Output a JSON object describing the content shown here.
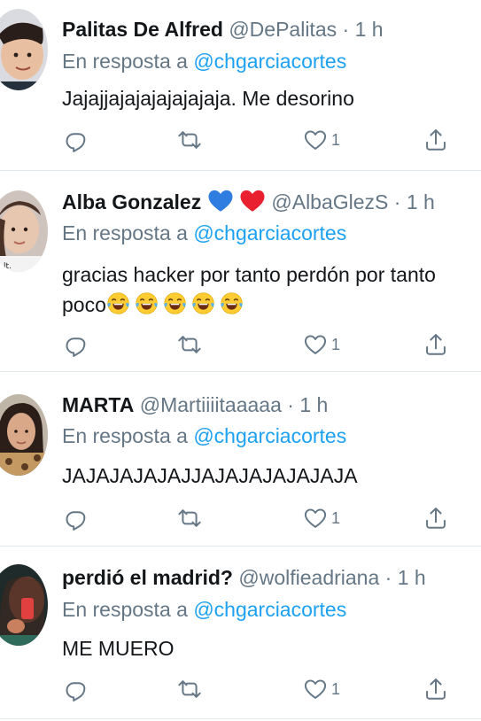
{
  "colors": {
    "text": "#14171a",
    "muted": "#657786",
    "link": "#1da1f2",
    "divider": "#e1e8ed",
    "icon": "#657786"
  },
  "tweets": [
    {
      "name": "Palitas De Alfred",
      "handle": "@DePalitas",
      "dot": "·",
      "time": "1 h",
      "reply_prefix": "En resposta a",
      "reply_to": "@chgarciacortes",
      "text_lines": [
        "Jajajjajajajajajajaja. Me desorino"
      ],
      "like_count": "1",
      "icons": [
        "reply-icon",
        "retweet-icon",
        "like-icon",
        "share-icon"
      ]
    },
    {
      "name": "Alba Gonzalez",
      "name_emojis": [
        "blue-heart-icon",
        "red-heart-icon"
      ],
      "handle": "@AlbaGlezS",
      "dot": "·",
      "time": "1 h",
      "reply_prefix": "En resposta a",
      "reply_to": "@chgarciacortes",
      "text_lines": [
        "gracias hacker por tanto perdón por tanto",
        "poco"
      ],
      "text_emojis": [
        "tears-of-joy-icon",
        "tears-of-joy-icon",
        "tears-of-joy-icon",
        "tears-of-joy-icon",
        "tears-of-joy-icon"
      ],
      "like_count": "1",
      "icons": [
        "reply-icon",
        "retweet-icon",
        "like-icon",
        "share-icon"
      ]
    },
    {
      "name": "MARTA",
      "handle": "@Martiiiitaaaaa",
      "dot": "·",
      "time": "1 h",
      "reply_prefix": "En resposta a",
      "reply_to": "@chgarciacortes",
      "text_lines": [
        "JAJAJAJAJAJJAJAJAJAJAJAJA"
      ],
      "like_count": "1",
      "icons": [
        "reply-icon",
        "retweet-icon",
        "like-icon",
        "share-icon"
      ]
    },
    {
      "name": "perdió el madrid?",
      "handle": "@wolfieadriana",
      "dot": "·",
      "time": "1 h",
      "reply_prefix": "En resposta a",
      "reply_to": "@chgarciacortes",
      "text_lines": [
        "ME MUERO"
      ],
      "like_count": "1",
      "icons": [
        "reply-icon",
        "retweet-icon",
        "like-icon",
        "share-icon"
      ]
    }
  ]
}
